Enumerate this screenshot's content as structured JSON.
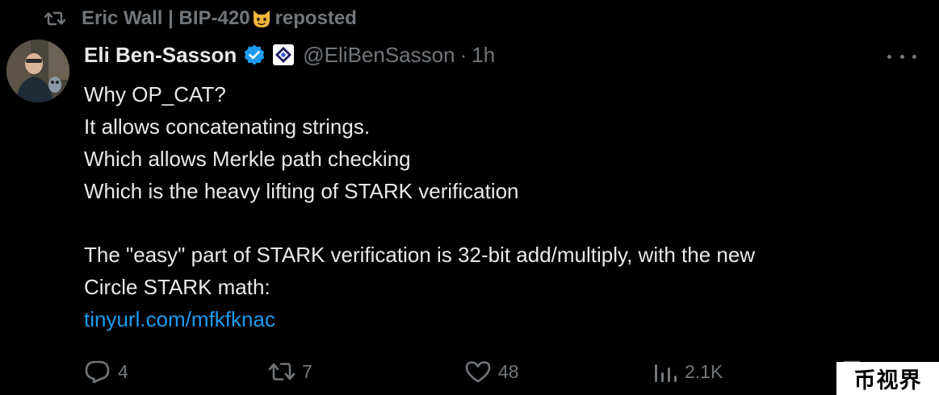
{
  "repost": {
    "user": "Eric Wall | BIP-420",
    "emoji": "cat-face-emoji",
    "label": "reposted"
  },
  "author": {
    "display_name": "Eli Ben-Sasson",
    "handle": "@EliBenSasson",
    "separator": "·",
    "time": "1h",
    "verified_color": "#1d9bf0"
  },
  "tweet": {
    "lines": [
      "Why OP_CAT?",
      "It allows concatenating strings.",
      "Which allows Merkle path checking",
      "Which is the heavy lifting of STARK verification",
      "",
      "The \"easy\" part of STARK verification is 32-bit add/multiply, with the new",
      "Circle STARK math:"
    ],
    "link": "tinyurl.com/mfkfknac"
  },
  "actions": {
    "replies": "4",
    "reposts": "7",
    "likes": "48",
    "views": "2.1K"
  },
  "watermark": "币视界",
  "colors": {
    "background": "#000000",
    "text": "#e7e9ea",
    "muted": "#71767b",
    "link": "#1d9bf0"
  }
}
